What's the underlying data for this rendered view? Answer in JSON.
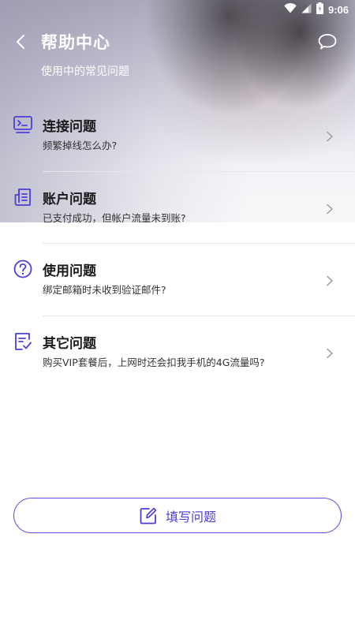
{
  "status_bar": {
    "time": "9:06"
  },
  "header": {
    "title": "帮助中心",
    "subtitle": "使用中的常见问题"
  },
  "faq": [
    {
      "title": "连接问题",
      "desc": "频繁掉线怎么办?",
      "icon": "terminal-icon"
    },
    {
      "title": "账户问题",
      "desc": "已支付成功，但帐户流量未到账?",
      "icon": "document-list-icon"
    },
    {
      "title": "使用问题",
      "desc": "绑定邮箱时未收到验证邮件?",
      "icon": "question-circle-icon"
    },
    {
      "title": "其它问题",
      "desc": "购买VIP套餐后，上网时还会扣我手机的4G流量吗?",
      "icon": "checklist-icon"
    }
  ],
  "submit": {
    "label": "填写问题",
    "icon": "edit-icon"
  },
  "colors": {
    "accent": "#4a40d6",
    "divider": "#e6e6ec"
  }
}
